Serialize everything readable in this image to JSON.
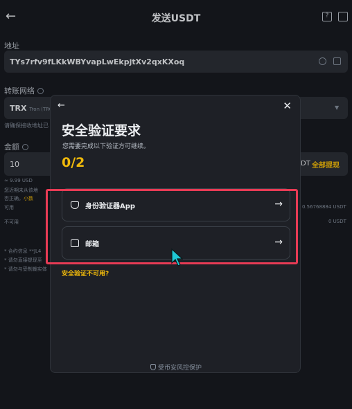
{
  "header": {
    "title": "发送USDT",
    "back_icon": "back-arrow-icon",
    "help_icon": "help-icon",
    "history_icon": "history-icon"
  },
  "form": {
    "address_label": "地址",
    "address_value": "TYs7rfv9fLKkWBYvapLwEkpjtXv2qxKXoq",
    "network_label": "转账网络",
    "network_value": "TRX",
    "network_sub": "Tron (TRC",
    "network_hint": "请确保接收地址已",
    "amount_label": "金额",
    "amount_value": "10",
    "amount_unit": "DT",
    "withdraw_all": "全部提现",
    "usd_value": "≈ 9.99 USD",
    "warn_line1": "您近期未从该地",
    "warn_line2": "否正确。",
    "warn_link": "小数",
    "available_label": "可用",
    "available_value": "0.56768884 USDT",
    "unavailable_label": "不可用",
    "unavailable_value": "0 USDT",
    "note1": "* 合约信息 **JL4",
    "note2": "* 请勿直接提现至",
    "note3": "* 请勿与受制裁实体"
  },
  "modal": {
    "title": "安全验证要求",
    "subtitle": "您需要完成以下验证方可继续。",
    "progress": "0/2",
    "options": [
      {
        "label": "身份验证器App",
        "icon": "shield-icon"
      },
      {
        "label": "邮箱",
        "icon": "mail-icon"
      }
    ],
    "unavailable_link": "安全验证不可用?",
    "footer": "受币安风控保护"
  },
  "colors": {
    "accent": "#f0b90b",
    "highlight": "#e83b55",
    "background": "#181a20"
  }
}
